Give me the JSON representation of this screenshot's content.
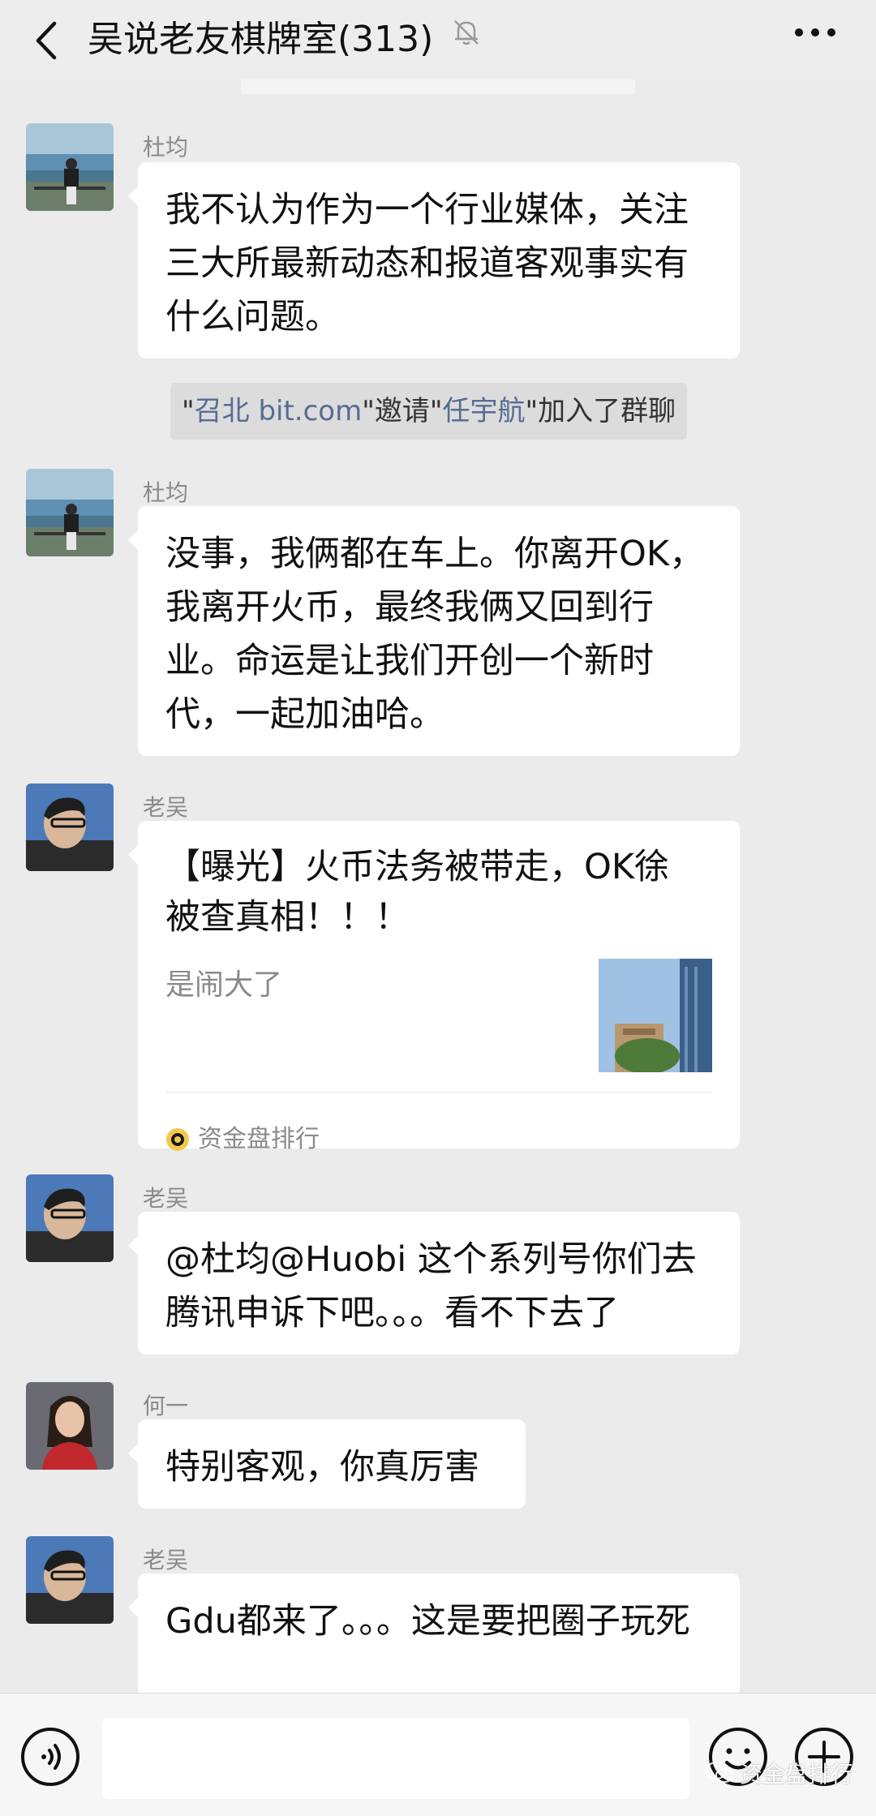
{
  "header": {
    "title": "吴说老友棋牌室(313)",
    "back_icon": "chevron-left-icon",
    "mute_icon": "bell-off-icon",
    "more_icon": "more-dots-icon"
  },
  "messages": [
    {
      "sender": "杜均",
      "text": "我不认为作为一个行业媒体，关注三大所最新动态和报道客观事实有什么问题。"
    },
    {
      "sender": "杜均",
      "text": "没事，我俩都在车上。你离开OK，我离开火币，最终我俩又回到行业。命运是让我们开创一个新时代，一起加油哈。"
    },
    {
      "sender": "老吴",
      "card": {
        "title": "【曝光】火币法务被带走，OK徐被查真相！！！",
        "desc": "是闹大了",
        "source": "资金盘排行"
      }
    },
    {
      "sender": "老吴",
      "text": "@杜均@Huobi 这个系列号你们去腾讯申诉下吧。。。看不下去了"
    },
    {
      "sender": "何一",
      "text": "特别客观，你真厉害"
    },
    {
      "sender": "老吴",
      "text": "Gdu都来了。。。这是要把圈子玩死"
    }
  ],
  "system_notice": {
    "q1": "\"",
    "inviter": "召北 bit.com",
    "mid": "\"邀请\"",
    "invitee": "任宇航",
    "tail": "\"加入了群聊"
  },
  "input_bar": {
    "voice_icon": "voice-icon",
    "emoji_icon": "emoji-icon",
    "plus_icon": "plus-icon"
  },
  "watermark": {
    "text": "资金盘排行"
  },
  "colors": {
    "chat_bg": "#ebebeb",
    "bubble": "#ffffff",
    "link": "#576b95"
  }
}
